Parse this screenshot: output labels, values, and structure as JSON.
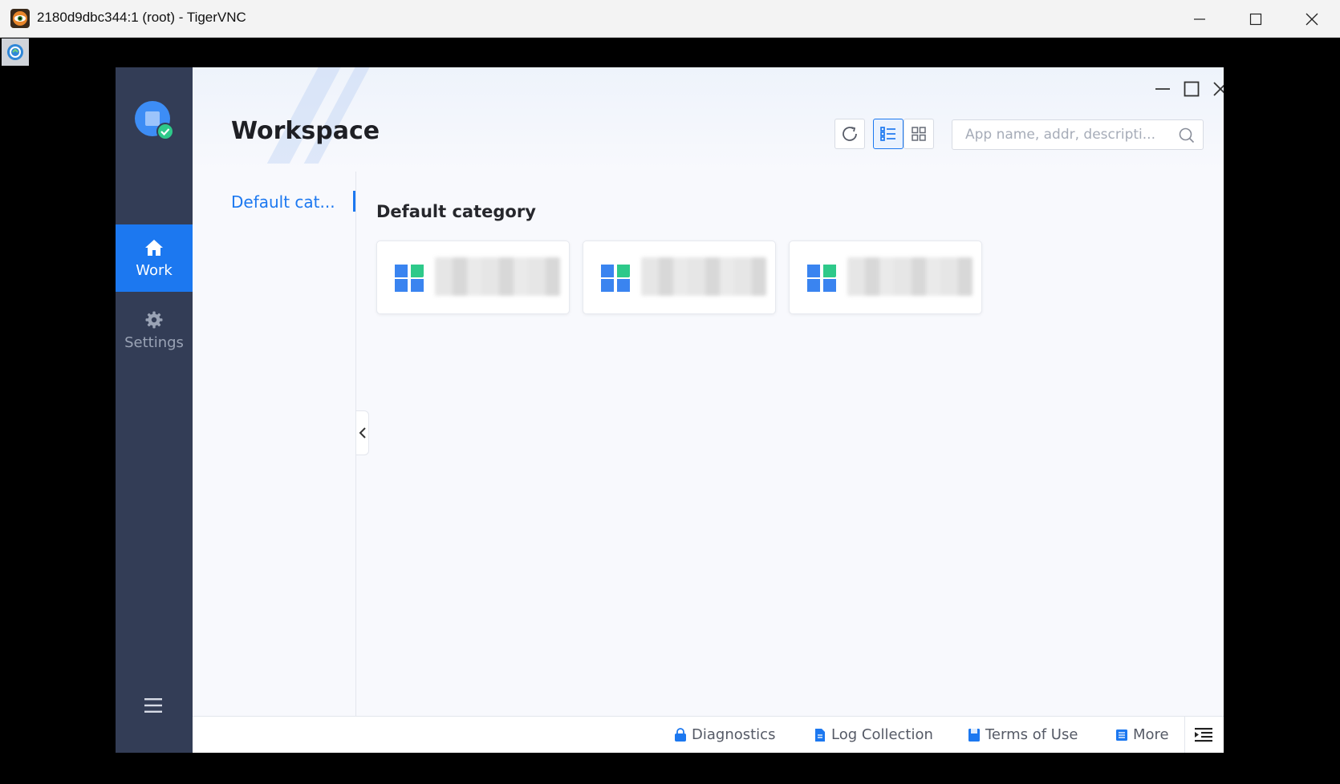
{
  "vnc": {
    "title": "2180d9dbc344:1 (root) - TigerVNC"
  },
  "sidebar": {
    "items": [
      {
        "label": "Work",
        "icon": "home-icon",
        "active": true
      },
      {
        "label": "Settings",
        "icon": "gear-icon",
        "active": false
      }
    ]
  },
  "header": {
    "title": "Workspace"
  },
  "search": {
    "placeholder": "App name, addr, descripti..."
  },
  "categories": {
    "items": [
      {
        "label": "Default cat..."
      }
    ]
  },
  "content": {
    "section_title": "Default category",
    "apps": [
      {
        "icon": "windows-app-icon"
      },
      {
        "icon": "windows-app-icon"
      },
      {
        "icon": "windows-app-icon"
      }
    ]
  },
  "footer": {
    "links": [
      {
        "label": "Diagnostics",
        "icon": "lock-icon"
      },
      {
        "label": "Log Collection",
        "icon": "document-icon"
      },
      {
        "label": "Terms of Use",
        "icon": "book-icon"
      },
      {
        "label": "More",
        "icon": "list-icon"
      }
    ]
  },
  "colors": {
    "accent": "#1c78f0",
    "sidebar_bg": "#333d56",
    "app_bg": "#f8f9fd"
  }
}
